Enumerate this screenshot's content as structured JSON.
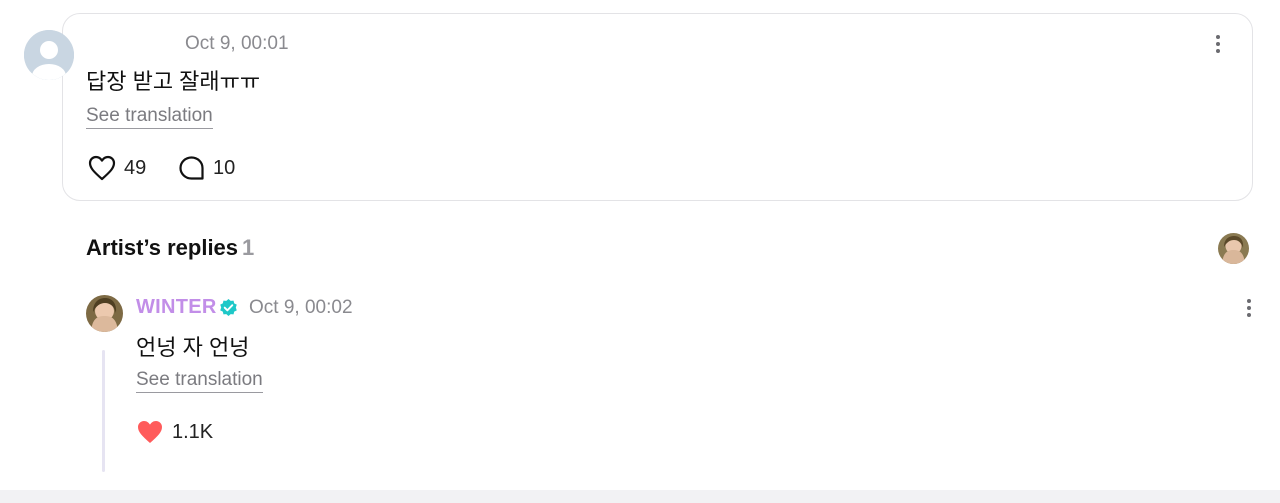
{
  "comment": {
    "timestamp": "Oct 9, 00:01",
    "text": "답장 받고 잘래ㅠㅠ",
    "see_translation": "See translation",
    "likes": "49",
    "replies": "10"
  },
  "artist_replies": {
    "title": "Artist’s replies",
    "count": "1"
  },
  "reply": {
    "author": "WINTER",
    "timestamp": "Oct 9, 00:02",
    "text": "언넝 자 언넝",
    "see_translation": "See translation",
    "likes": "1.1K"
  },
  "colors": {
    "author": "#c28ee8",
    "verified": "#1ec8c8",
    "heart_filled": "#ff5b5b",
    "muted_text": "#8a8a8f"
  },
  "icons": [
    "user-avatar-placeholder-icon",
    "more-options-icon",
    "heart-outline-icon",
    "comment-bubble-icon",
    "verified-badge-icon",
    "heart-filled-icon"
  ]
}
